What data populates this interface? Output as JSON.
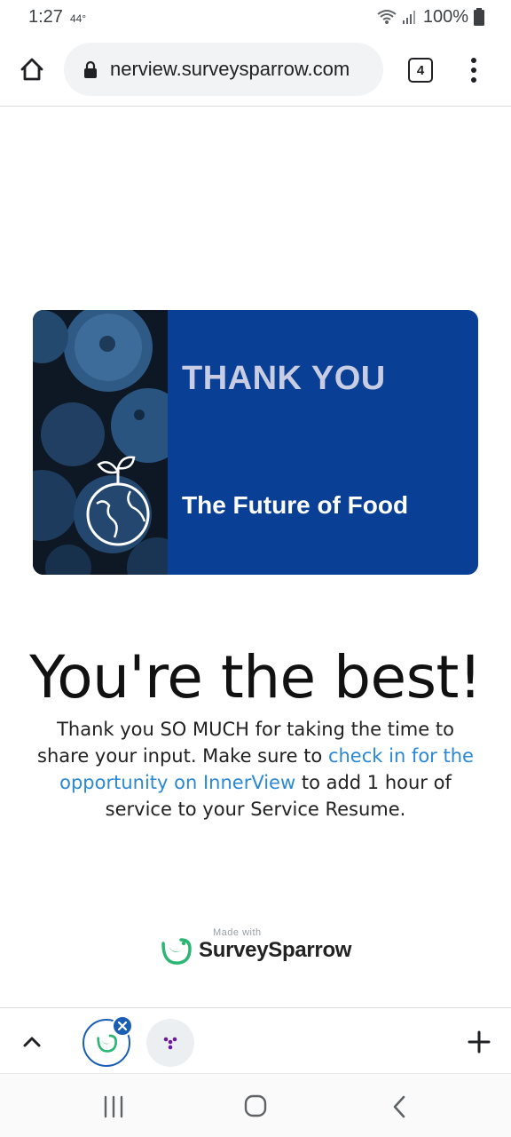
{
  "status_bar": {
    "time": "1:27",
    "temperature": "44°",
    "battery": "100%"
  },
  "browser": {
    "url": "nerview.surveysparrow.com",
    "tab_count": "4",
    "icons": [
      "home-icon",
      "lock-icon",
      "tab-switcher-icon",
      "more-vert-icon"
    ]
  },
  "banner": {
    "title": "THANK YOU",
    "subtitle": "The Future of Food",
    "background_color": "#0a3f96"
  },
  "content": {
    "headline": "You're the best!",
    "message_before": "Thank you SO MUCH for taking the time to share your input. Make sure to ",
    "message_link": "check in for the opportunity on InnerView",
    "message_after": " to add 1 hour of service to your Service Resume.",
    "link_color": "#2a88d6"
  },
  "footer": {
    "made_with": "Made with",
    "brand": "SurveySparrow"
  },
  "tab_strip": {
    "icons": [
      "chevron-up-icon",
      "active-tab-favicon",
      "close-icon",
      "tab-favicon",
      "plus-icon"
    ]
  },
  "system_nav": {
    "icons": [
      "recents-icon",
      "home-circle-icon",
      "back-icon"
    ]
  }
}
